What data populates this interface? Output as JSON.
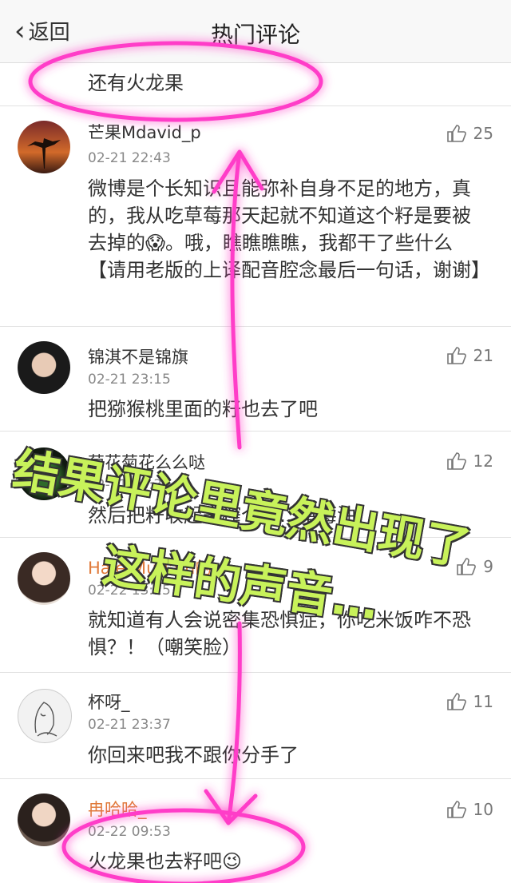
{
  "header": {
    "back_label": "返回",
    "title": "热门评论"
  },
  "first_row": {
    "text": "还有火龙果"
  },
  "comments": [
    {
      "user": "芒果Mdavid_p",
      "time": "02-21 22:43",
      "likes": "25",
      "text": "微博是个长知识且能弥补自身不足的地方，真的，我从吃草莓那天起就不知道这个籽是要被去掉的😱。哦，瞧瞧瞧瞧，我都干了些什么【请用老版的上译配音腔念最后一句话，谢谢】"
    },
    {
      "user": "锦淇不是锦旗",
      "time": "02-21 23:15",
      "likes": "21",
      "text": "把猕猴桃里面的籽也去了吧"
    },
    {
      "user": "菊花菊花么么哒",
      "time": "02-21 23:31",
      "likes": "12",
      "text": "然后把籽收起来榨个油…草莓油"
    },
    {
      "user": "Hale-Muriam的",
      "time": "02-22 13:15",
      "likes": "9",
      "text": "就知道有人会说密集恐惧症，你吃米饭咋不恐惧？！（嘲笑脸）"
    },
    {
      "user": "杯呀_",
      "time": "02-21 23:37",
      "likes": "11",
      "text": "你回来吧我不跟你分手了"
    },
    {
      "user": "冉哈哈_",
      "time": "02-22 09:53",
      "likes": "10",
      "text": "火龙果也去籽吧😉"
    }
  ],
  "overlay": {
    "line1": "结果评论里竟然出现了",
    "line2": "这样的声音…"
  },
  "colors": {
    "highlight_pink": "#ff3cc8",
    "caption_green": "#c8f25a"
  }
}
